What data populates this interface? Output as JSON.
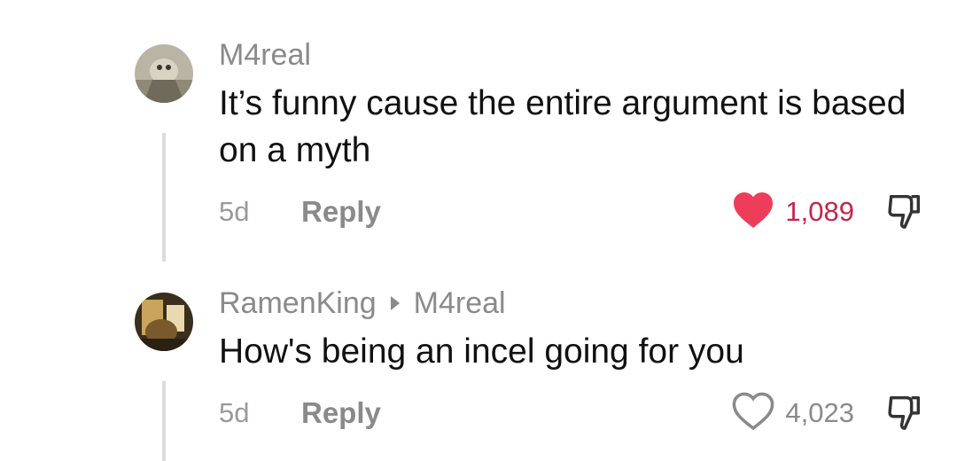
{
  "comments": [
    {
      "username": "M4real",
      "reply_to": "",
      "text": "It’s funny cause the entire argument is based on a myth",
      "time": "5d",
      "reply_label": "Reply",
      "likes": "1,089",
      "liked": true,
      "avatar_icon": "avatar-image"
    },
    {
      "username": "RamenKing",
      "reply_to": "M4real",
      "text": "How's being an incel going for you",
      "time": "5d",
      "reply_label": "Reply",
      "likes": "4,023",
      "liked": false,
      "avatar_icon": "avatar-image"
    }
  ],
  "colors": {
    "liked_heart": "#ee3d5a",
    "liked_count": "#c4254a",
    "muted": "#8a8a8a"
  }
}
